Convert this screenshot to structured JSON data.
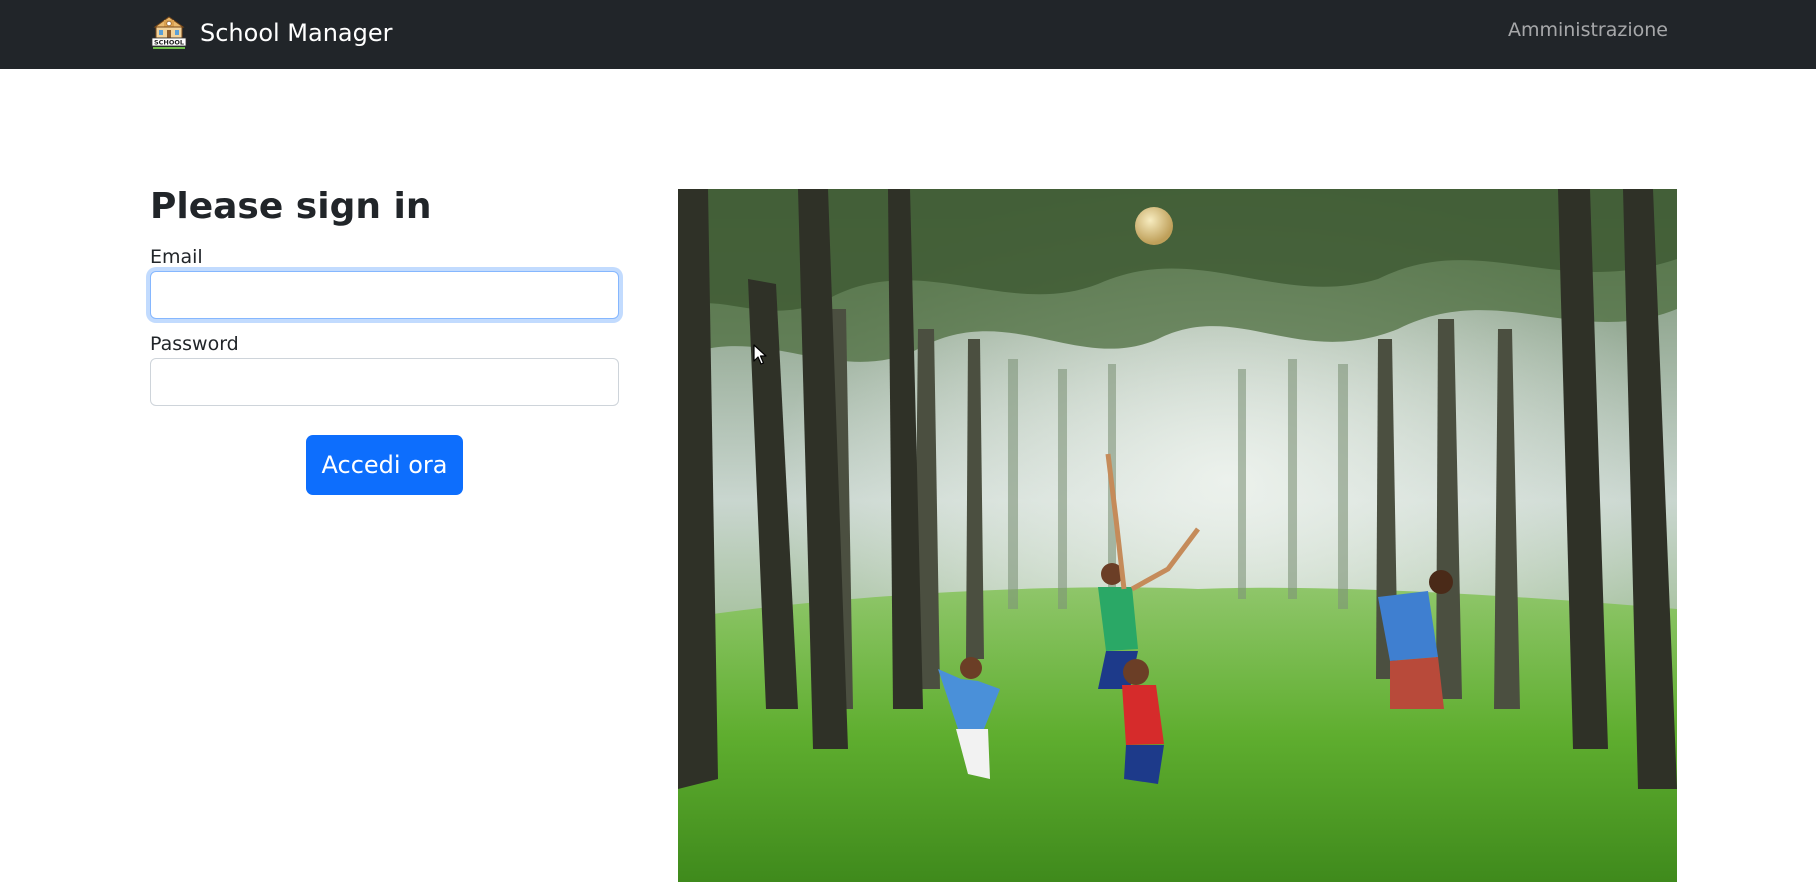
{
  "navbar": {
    "brand_name": "School Manager",
    "logo_icon": "school-building-icon",
    "logo_text": "SCHOOL",
    "admin_link": "Amministrazione"
  },
  "signin": {
    "title": "Please sign in",
    "email_label": "Email",
    "email_value": "",
    "password_label": "Password",
    "password_value": "",
    "submit_label": "Accedi ora"
  },
  "hero_image": {
    "alt": "Children jumping for a ball in a misty forest",
    "icon": "photo"
  },
  "colors": {
    "navbar_bg": "#212529",
    "primary": "#0d6efd",
    "focus_border": "#86b7fe"
  }
}
